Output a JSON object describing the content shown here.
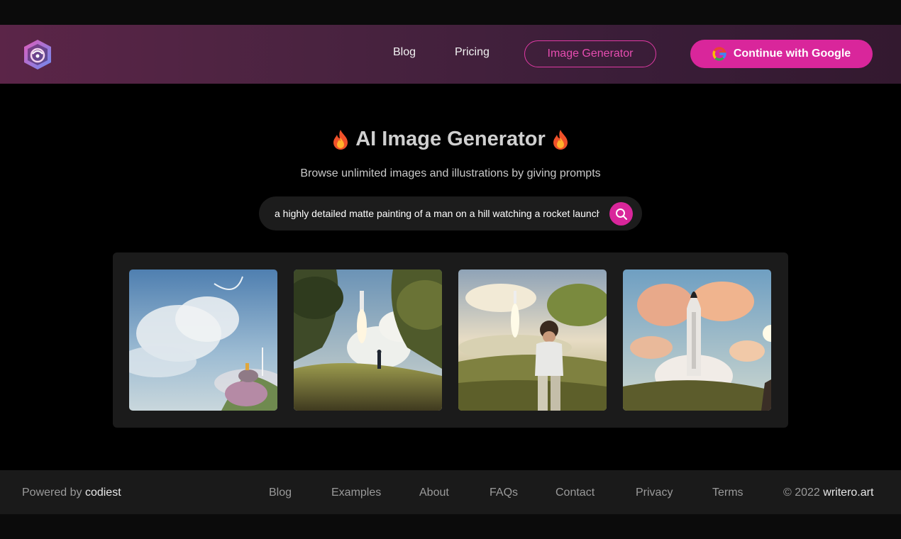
{
  "header": {
    "nav": {
      "blog": "Blog",
      "pricing": "Pricing",
      "image_generator": "Image Generator"
    },
    "google_button": "Continue with Google"
  },
  "hero": {
    "title": "AI Image Generator",
    "subtitle": "Browse unlimited images and illustrations by giving prompts"
  },
  "search": {
    "value": "a highly detailed matte painting of a man on a hill watching a rocket launch"
  },
  "gallery": {
    "image_count": 4
  },
  "footer": {
    "powered_prefix": "Powered by",
    "powered_brand": "codiest",
    "links": [
      "Blog",
      "Examples",
      "About",
      "FAQs",
      "Contact",
      "Privacy",
      "Terms"
    ],
    "copyright_prefix": "© 2022",
    "copyright_brand": "writero.art"
  },
  "colors": {
    "accent": "#d9269b",
    "background": "#000000",
    "header_gradient_start": "#5b2548",
    "header_gradient_end": "#33192f"
  },
  "icons": [
    "app-logo-icon",
    "google-icon",
    "fire-icon",
    "search-icon"
  ]
}
